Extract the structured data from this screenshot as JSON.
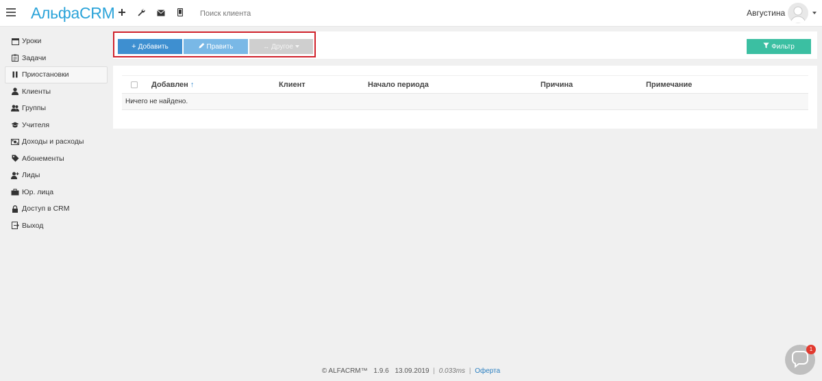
{
  "header": {
    "logo": "АльфаCRM",
    "search_placeholder": "Поиск клиента",
    "user_name": "Августина",
    "icons": [
      "plus-icon",
      "wrench-icon",
      "envelope-icon",
      "mobile-icon"
    ]
  },
  "sidebar": {
    "items": [
      {
        "label": "Уроки",
        "icon": "calendar-icon"
      },
      {
        "label": "Задачи",
        "icon": "clipboard-icon"
      },
      {
        "label": "Приостановки",
        "icon": "pause-icon",
        "active": true
      },
      {
        "label": "Клиенты",
        "icon": "user-icon"
      },
      {
        "label": "Группы",
        "icon": "users-icon"
      },
      {
        "label": "Учителя",
        "icon": "graduation-cap-icon"
      },
      {
        "label": "Доходы и расходы",
        "icon": "money-icon"
      },
      {
        "label": "Абонементы",
        "icon": "tag-icon"
      },
      {
        "label": "Лиды",
        "icon": "user-plus-icon"
      },
      {
        "label": "Юр. лица",
        "icon": "briefcase-icon"
      },
      {
        "label": "Доступ в CRM",
        "icon": "lock-icon"
      },
      {
        "label": "Выход",
        "icon": "sign-out-icon"
      }
    ]
  },
  "toolbar": {
    "add_label": "Добавить",
    "edit_label": "Править",
    "other_label": "Другое",
    "filter_label": "Фильтр"
  },
  "table": {
    "columns": [
      "Добавлен",
      "Клиент",
      "Начало периода",
      "Причина",
      "Примечание"
    ],
    "sort_indicator": "↑",
    "empty_text": "Ничего не найдено."
  },
  "footer": {
    "copyright": "© ALFACRM™",
    "version": "1.9.6",
    "date": "13.09.2019",
    "timing": "0.033ms",
    "offer_link": "Оферта"
  },
  "chat": {
    "badge_count": "1"
  },
  "colors": {
    "accent": "#2aa3d9",
    "add_button": "#3e8fd0",
    "edit_button": "#79b8e6",
    "other_button": "#cfcfcf",
    "filter_button": "#3bbfa2",
    "highlight": "#d0202a"
  }
}
